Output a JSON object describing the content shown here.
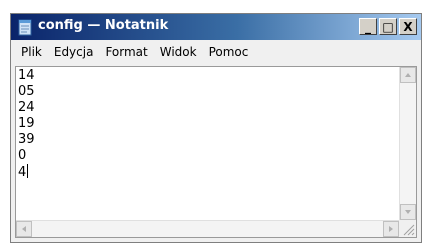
{
  "window": {
    "title": "config — Notatnik",
    "minimize_glyph": "_",
    "maximize_glyph": "□",
    "close_glyph": "X",
    "titlebar_color_start": "#0a246a",
    "titlebar_color_end": "#a6caf0"
  },
  "menu": {
    "items": [
      {
        "label": "Plik"
      },
      {
        "label": "Edycja"
      },
      {
        "label": "Format"
      },
      {
        "label": "Widok"
      },
      {
        "label": "Pomoc"
      }
    ]
  },
  "editor": {
    "lines": [
      "14",
      "05",
      "24",
      "19",
      "39",
      "0",
      "4"
    ],
    "caret_line": 6
  },
  "icons": {
    "app": "notepad-icon",
    "scroll_up": "arrow-up-icon",
    "scroll_down": "arrow-down-icon",
    "scroll_left": "arrow-left-icon",
    "scroll_right": "arrow-right-icon",
    "resize": "resize-grip-icon"
  }
}
